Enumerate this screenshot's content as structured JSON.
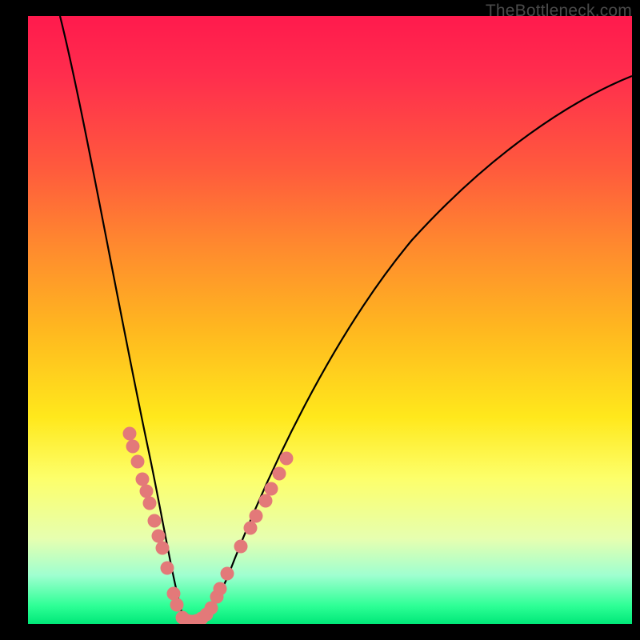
{
  "watermark": "TheBottleneck.com",
  "chart_data": {
    "type": "line",
    "title": "",
    "xlabel": "",
    "ylabel": "",
    "xlim": [
      0,
      100
    ],
    "ylim": [
      0,
      100
    ],
    "x": [
      0,
      2,
      4,
      6,
      8,
      10,
      12,
      14,
      16,
      18,
      20,
      22,
      24,
      26,
      28,
      30,
      32,
      40,
      50,
      60,
      70,
      80,
      90,
      100
    ],
    "values": [
      100,
      92,
      83,
      74,
      65,
      56,
      47,
      39,
      32,
      25,
      18,
      10,
      3,
      0,
      0,
      3,
      8,
      19,
      32,
      44,
      55,
      64,
      71,
      77
    ],
    "series": [
      {
        "name": "bottleneck-curve",
        "x": [
          0,
          2,
          4,
          6,
          8,
          10,
          12,
          14,
          16,
          18,
          20,
          22,
          24,
          26,
          28,
          30,
          32,
          40,
          50,
          60,
          70,
          80,
          90,
          100
        ],
        "values": [
          100,
          92,
          83,
          74,
          65,
          56,
          47,
          39,
          32,
          25,
          18,
          10,
          3,
          0,
          0,
          3,
          8,
          19,
          32,
          44,
          55,
          64,
          71,
          77
        ]
      },
      {
        "name": "dots-left",
        "x": [
          16.0,
          16.5,
          17.3,
          18.2,
          18.8,
          19.4,
          20.2,
          20.9,
          21.5,
          22.4,
          23.4,
          23.9
        ],
        "values": [
          32.0,
          30.0,
          27.5,
          24.5,
          22.5,
          20.5,
          17.5,
          15.0,
          13.0,
          9.5,
          5.0,
          3.0
        ]
      },
      {
        "name": "dots-right",
        "x": [
          29.5,
          30.5,
          31.0,
          32.2,
          34.5,
          36.0,
          37.0,
          38.5,
          39.5,
          40.8,
          42.0
        ],
        "values": [
          2.0,
          4.0,
          5.5,
          8.0,
          12.5,
          15.5,
          17.5,
          20.0,
          22.0,
          24.5,
          27.0
        ]
      },
      {
        "name": "dots-bottom",
        "x": [
          24.8,
          25.6,
          26.4,
          27.2,
          28.0,
          28.8
        ],
        "values": [
          0.2,
          0.0,
          0.0,
          0.0,
          0.2,
          0.8
        ]
      }
    ],
    "colors": {
      "curve": "#000000",
      "dots": "#e37979",
      "gradient_top": "#ff1a4d",
      "gradient_bottom": "#00e878"
    }
  }
}
